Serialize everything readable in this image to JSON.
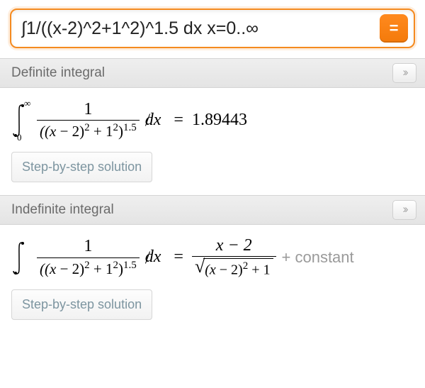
{
  "input": {
    "expression": "∫1/((x-2)^2+1^2)^1.5 dx x=0..∞"
  },
  "compute_button": {
    "glyph": "="
  },
  "sections": {
    "definite": {
      "title": "Definite integral",
      "expand_glyph": "››",
      "integral": {
        "lower": "0",
        "upper": "∞",
        "numerator": "1",
        "denominator_base": "((x − 2)",
        "denominator_sq": "2",
        "denominator_plus": " + 1",
        "denominator_sq2": "2",
        "denominator_close": ")",
        "denominator_outerexp": "1.5",
        "dx": "dx",
        "equals": "=",
        "value": "1.89443"
      },
      "step_button": "Step-by-step solution"
    },
    "indefinite": {
      "title": "Indefinite integral",
      "expand_glyph": "››",
      "integral": {
        "numerator": "1",
        "denominator_base": "((x − 2)",
        "denominator_sq": "2",
        "denominator_plus": " + 1",
        "denominator_sq2": "2",
        "denominator_close": ")",
        "denominator_outerexp": "1.5",
        "dx": "dx",
        "equals": "=",
        "rhs_num": "x − 2",
        "rhs_radicand_a": "(x − 2)",
        "rhs_radicand_exp": "2",
        "rhs_radicand_b": " + 1",
        "constant": "+ constant"
      },
      "step_button": "Step-by-step solution"
    }
  }
}
